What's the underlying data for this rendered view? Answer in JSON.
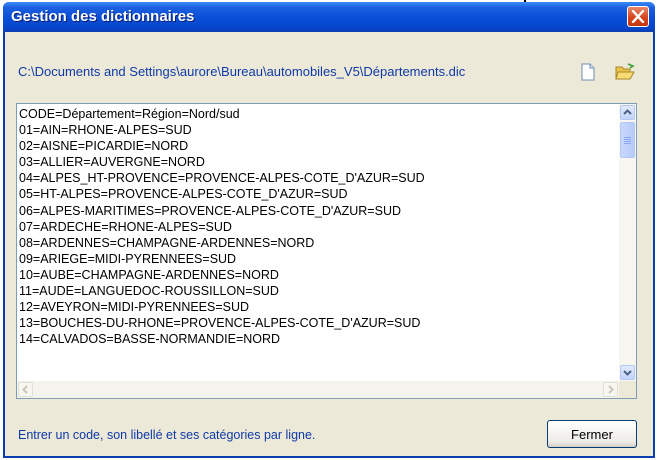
{
  "window": {
    "title": "Gestion des dictionnaires",
    "close_icon": "close-icon",
    "titlebar_color": "#0a4fd8",
    "close_color": "#d6451e"
  },
  "file_path": "C:\\Documents and Settings\\aurore\\Bureau\\automobiles_V5\\Départements.dic",
  "toolbar": {
    "new_icon": "new-document-icon",
    "open_icon": "open-folder-icon"
  },
  "dictionary": {
    "lines": [
      "CODE=Département=Région=Nord/sud",
      "01=AIN=RHONE-ALPES=SUD",
      "02=AISNE=PICARDIE=NORD",
      "03=ALLIER=AUVERGNE=NORD",
      "04=ALPES_HT-PROVENCE=PROVENCE-ALPES-COTE_D'AZUR=SUD",
      "05=HT-ALPES=PROVENCE-ALPES-COTE_D'AZUR=SUD",
      "06=ALPES-MARITIMES=PROVENCE-ALPES-COTE_D'AZUR=SUD",
      "07=ARDECHE=RHONE-ALPES=SUD",
      "08=ARDENNES=CHAMPAGNE-ARDENNES=NORD",
      "09=ARIEGE=MIDI-PYRENNEES=SUD",
      "10=AUBE=CHAMPAGNE-ARDENNES=NORD",
      "11=AUDE=LANGUEDOC-ROUSSILLON=SUD",
      "12=AVEYRON=MIDI-PYRENNEES=SUD",
      "13=BOUCHES-DU-RHONE=PROVENCE-ALPES-COTE_D'AZUR=SUD",
      "14=CALVADOS=BASSE-NORMANDIE=NORD"
    ]
  },
  "hint": "Entrer un code, son libellé et ses catégories par ligne.",
  "buttons": {
    "close_label": "Fermer"
  },
  "annotation": {
    "arrow_icon": "down-arrow-icon"
  }
}
